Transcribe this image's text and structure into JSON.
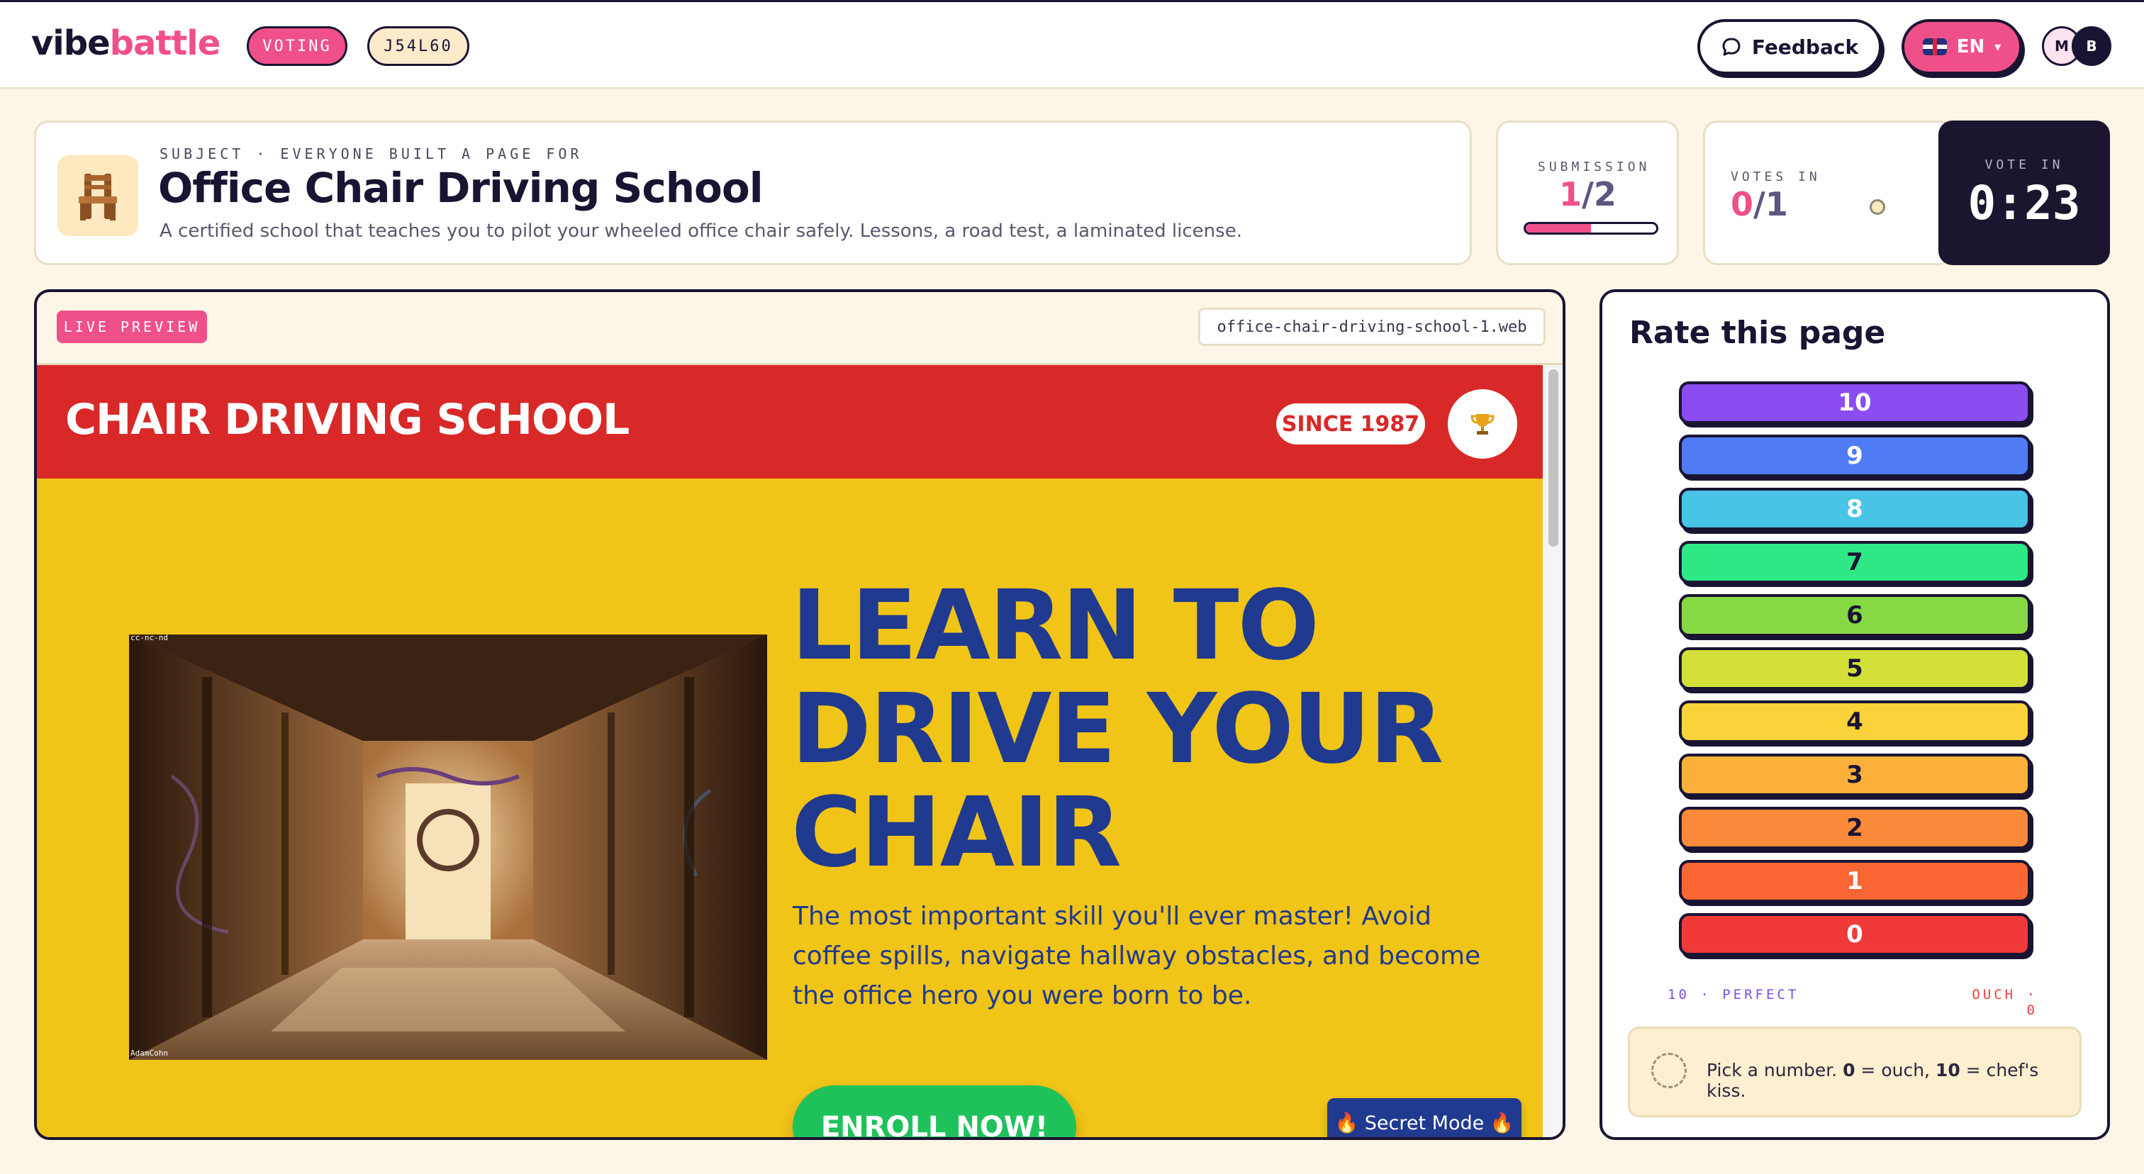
{
  "app": {
    "logo_part1": "vibe",
    "logo_part2": "battle",
    "status": "VOTING",
    "room_code": "J54L60",
    "feedback_label": "Feedback",
    "language_label": "EN",
    "language_caret": "▾",
    "avatars": [
      "M",
      "B"
    ]
  },
  "subject": {
    "eyebrow": "SUBJECT · EVERYONE BUILT A PAGE FOR",
    "title": "Office Chair Driving School",
    "description": "A certified school that teaches you to pilot your wheeled office chair safely. Lessons, a road test, a laminated license.",
    "icon": "chair-icon"
  },
  "stats": {
    "submission_label": "SUBMISSION",
    "submission_current": "1",
    "submission_total": "/2",
    "submission_progress": 0.5,
    "votes_label": "VOTES IN",
    "votes_current": "0",
    "votes_total": "/1",
    "timer_label": "VOTE IN",
    "timer_value": "0:23"
  },
  "preview": {
    "badge": "LIVE PREVIEW",
    "url": "office-chair-driving-school-1.web",
    "site": {
      "name": "CHAIR DRIVING SCHOOL",
      "since": "SINCE 1987",
      "trophy_icon": "trophy-icon",
      "photo_credit_top": "cc-nc-nd",
      "photo_credit_bottom": "AdamCohn",
      "hero_lines": [
        "LEARN TO",
        "DRIVE YOUR",
        "CHAIR"
      ],
      "hero_subtitle": "The most important skill you'll ever master! Avoid coffee spills, navigate hallway obstacles, and become the office hero you were born to be.",
      "cta": "ENROLL NOW!",
      "secret": "🔥 Secret Mode 🔥"
    }
  },
  "rating": {
    "title": "Rate this page",
    "scores": [
      {
        "label": "10",
        "color": "#8b4cf0",
        "text": "#ffffff"
      },
      {
        "label": "9",
        "color": "#4f7cf5",
        "text": "#ffffff"
      },
      {
        "label": "8",
        "color": "#47c4e6",
        "text": "#ffffff"
      },
      {
        "label": "7",
        "color": "#2ee886",
        "text": "#1a1433"
      },
      {
        "label": "6",
        "color": "#86d943",
        "text": "#1a1433"
      },
      {
        "label": "5",
        "color": "#d3e03a",
        "text": "#1a1433"
      },
      {
        "label": "4",
        "color": "#fad23a",
        "text": "#1a1433"
      },
      {
        "label": "3",
        "color": "#fbb03b",
        "text": "#1a1433"
      },
      {
        "label": "2",
        "color": "#fb8a3a",
        "text": "#1a1433"
      },
      {
        "label": "1",
        "color": "#fa6534",
        "text": "#ffffff"
      },
      {
        "label": "0",
        "color": "#f03a3a",
        "text": "#ffffff"
      }
    ],
    "scale_left": "10 · PERFECT",
    "scale_right": "OUCH · 0",
    "hint_prefix": "Pick a number. ",
    "hint_zero": "0",
    "hint_mid": " = ouch, ",
    "hint_ten": "10",
    "hint_suffix": " = chef's kiss."
  }
}
